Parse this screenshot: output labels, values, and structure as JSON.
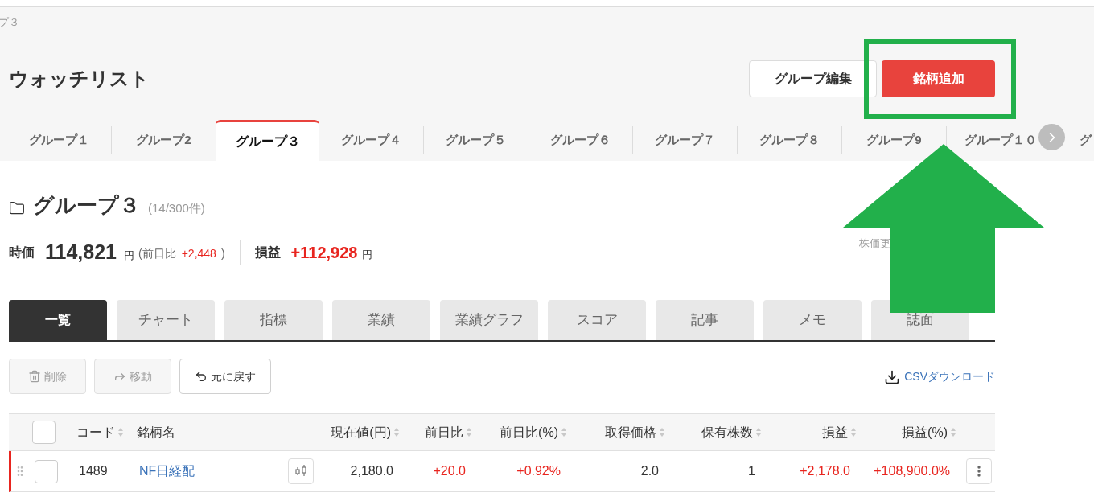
{
  "breadcrumb": "プ３",
  "page_title": "ウォッチリスト",
  "header_buttons": [
    {
      "label": "グループ編集",
      "kind": "secondary"
    },
    {
      "label": "銘柄追加",
      "kind": "primary"
    }
  ],
  "group_tabs": [
    {
      "label": "グループ１",
      "selected": false
    },
    {
      "label": "グループ2",
      "selected": false
    },
    {
      "label": "グループ３",
      "selected": true
    },
    {
      "label": "グループ４",
      "selected": false
    },
    {
      "label": "グループ５",
      "selected": false
    },
    {
      "label": "グループ６",
      "selected": false
    },
    {
      "label": "グループ７",
      "selected": false
    },
    {
      "label": "グループ８",
      "selected": false
    },
    {
      "label": "グループ9",
      "selected": false
    },
    {
      "label": "グループ１０",
      "selected": false
    },
    {
      "label": "グ",
      "selected": false
    }
  ],
  "group": {
    "name": "グループ３",
    "count": "(14/300件)"
  },
  "stats": {
    "price_label": "時価",
    "price": "114,821",
    "price_unit": "円",
    "change_open": "(前日比",
    "change": "+2,448",
    "change_close": ")",
    "pl_label": "損益",
    "pl": "+112,928",
    "pl_unit": "円",
    "update_note": "株価更"
  },
  "view_tabs": [
    {
      "label": "一覧",
      "selected": true
    },
    {
      "label": "チャート",
      "selected": false
    },
    {
      "label": "指標",
      "selected": false
    },
    {
      "label": "業績",
      "selected": false
    },
    {
      "label": "業績グラフ",
      "selected": false
    },
    {
      "label": "スコア",
      "selected": false
    },
    {
      "label": "記事",
      "selected": false
    },
    {
      "label": "メモ",
      "selected": false
    },
    {
      "label": "誌面",
      "selected": false
    }
  ],
  "actions": [
    {
      "label": "削除",
      "kind": "delete",
      "disabled": true
    },
    {
      "label": "移動",
      "kind": "move",
      "disabled": true
    },
    {
      "label": "元に戻す",
      "kind": "undo",
      "disabled": false
    }
  ],
  "csv_link": "CSVダウンロード",
  "table": {
    "select_all_checked": false,
    "columns": [
      {
        "label": "コード",
        "sortable": true
      },
      {
        "label": "銘柄名",
        "sortable": false
      },
      {
        "label": "現在値(円)",
        "sortable": true
      },
      {
        "label": "前日比",
        "sortable": true
      },
      {
        "label": "前日比(%)",
        "sortable": true
      },
      {
        "label": "取得価格",
        "sortable": true
      },
      {
        "label": "保有株数",
        "sortable": true
      },
      {
        "label": "損益",
        "sortable": true
      },
      {
        "label": "損益(%)",
        "sortable": true
      }
    ],
    "rows": [
      {
        "marked": true,
        "checked": false,
        "code": "1489",
        "name": "NF日経配",
        "price": "2,180.0",
        "change": "+20.0",
        "change_pct": "+0.92%",
        "cost": "2.0",
        "shares": "1",
        "pl": "+2,178.0",
        "pl_pct": "+108,900.0%"
      }
    ]
  }
}
